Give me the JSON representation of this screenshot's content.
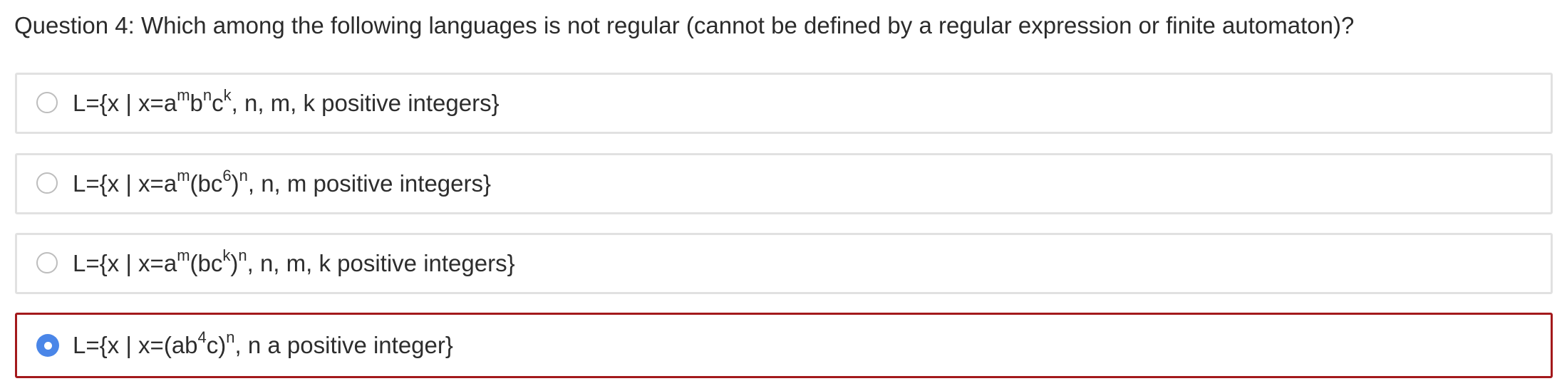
{
  "question": {
    "text": "Question 4: Which among the following languages is not regular (cannot be defined by a regular expression or finite automaton)?"
  },
  "options": [
    {
      "parts": [
        "L={x | x=a",
        "m",
        "b",
        "n",
        "c",
        "k",
        ", n, m, k positive integers}"
      ],
      "selected": false
    },
    {
      "parts": [
        "L={x | x=a",
        "m",
        "(bc",
        "6",
        ")",
        "n",
        ", n, m positive integers}"
      ],
      "selected": false
    },
    {
      "parts": [
        "L={x | x=a",
        "m",
        "(bc",
        "k",
        ")",
        "n",
        ", n, m, k positive integers}"
      ],
      "selected": false
    },
    {
      "parts": [
        "L={x | x=(ab",
        "4",
        "c)",
        "n",
        ", n a positive integer}"
      ],
      "selected": true
    }
  ],
  "colors": {
    "selected_border": "#a3191c",
    "radio_checked": "#4a86e8",
    "option_border": "#e1e1e1"
  }
}
